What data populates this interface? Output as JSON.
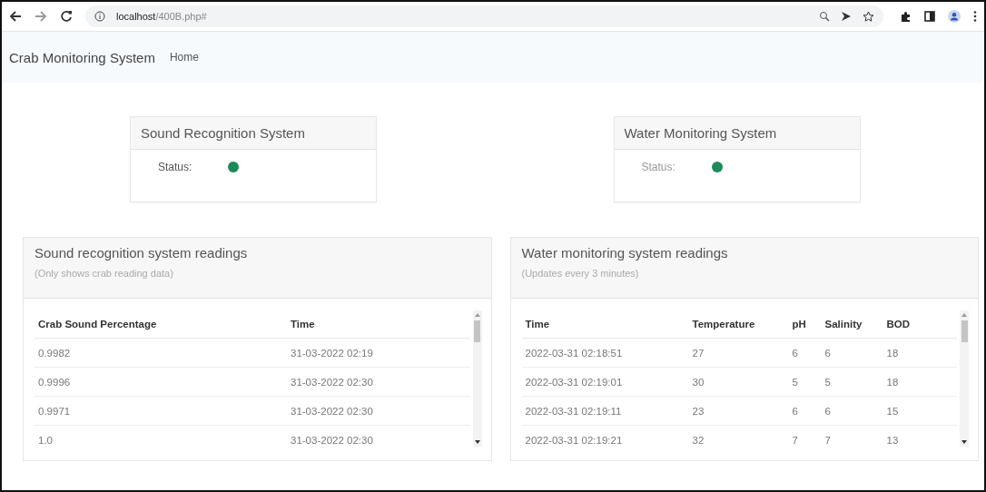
{
  "browser": {
    "url_host": "localhost",
    "url_path": "/400B.php#"
  },
  "navbar": {
    "brand": "Crab Monitoring System",
    "links": [
      {
        "label": "Home",
        "selected": false
      }
    ]
  },
  "status_cards": [
    {
      "title": "Sound Recognition System",
      "label": "Status:",
      "online": true
    },
    {
      "title": "Water Monitoring System",
      "label": "Status:",
      "online": true
    }
  ],
  "panels": [
    {
      "title": "Sound recognition system readings",
      "subtitle": "(Only shows crab reading data)",
      "columns": [
        "Crab Sound Percentage",
        "Time"
      ],
      "rows": [
        [
          "0.9982",
          "31-03-2022 02:19"
        ],
        [
          "0.9996",
          "31-03-2022 02:30"
        ],
        [
          "0.9971",
          "31-03-2022 02:30"
        ],
        [
          "1.0",
          "31-03-2022 02:30"
        ]
      ]
    },
    {
      "title": "Water monitoring system readings",
      "subtitle": "(Updates every 3 minutes)",
      "columns": [
        "Time",
        "Temperature",
        "pH",
        "Salinity",
        "BOD"
      ],
      "rows": [
        [
          "2022-03-31 02:18:51",
          "27",
          "6",
          "6",
          "18"
        ],
        [
          "2022-03-31 02:19:01",
          "30",
          "5",
          "5",
          "18"
        ],
        [
          "2022-03-31 02:19:11",
          "23",
          "6",
          "6",
          "15"
        ],
        [
          "2022-03-31 02:19:21",
          "32",
          "7",
          "7",
          "13"
        ]
      ]
    }
  ]
}
